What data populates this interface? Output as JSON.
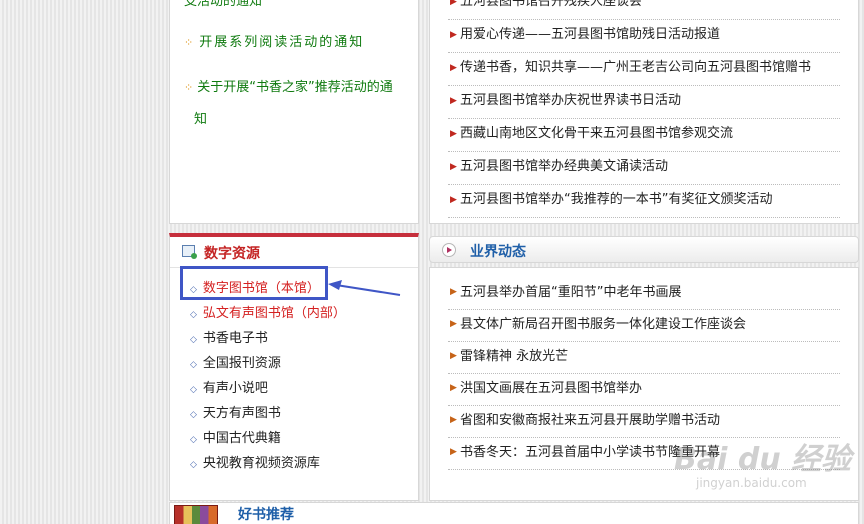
{
  "notices": [
    {
      "text": "支活动的通知",
      "cont": ""
    },
    {
      "text": "开展系列阅读活动的通知",
      "cont": ""
    },
    {
      "text": "关于开展“书香之家”推荐活动的通",
      "cont": "知"
    }
  ],
  "news_top": [
    "五河县图书馆召开残疾人座谈会",
    "用爱心传递——五河县图书馆助残日活动报道",
    "传递书香，知识共享——广州王老吉公司向五河县图书馆赠书",
    "五河县图书馆举办庆祝世界读书日活动",
    "西藏山南地区文化骨干来五河县图书馆参观交流",
    "五河县图书馆举办经典美文诵读活动",
    "五河县图书馆举办“我推荐的一本书”有奖征文颁奖活动"
  ],
  "digital_resources": {
    "title": "数字资源",
    "items": [
      {
        "label": "数字图书馆（本馆）",
        "highlight": true
      },
      {
        "label": "弘文有声图书馆（内部）",
        "highlight": true
      },
      {
        "label": "书香电子书",
        "highlight": false
      },
      {
        "label": "全国报刊资源",
        "highlight": false
      },
      {
        "label": "有声小说吧",
        "highlight": false
      },
      {
        "label": "天方有声图书",
        "highlight": false
      },
      {
        "label": "中国古代典籍",
        "highlight": false
      },
      {
        "label": "央视教育视频资源库",
        "highlight": false
      }
    ]
  },
  "industry_news": {
    "title": "业界动态",
    "items": [
      "五河县举办首届“重阳节”中老年书画展",
      "县文体广新局召开图书服务一体化建设工作座谈会",
      "雷锋精神 永放光芒",
      "洪国文画展在五河县图书馆举办",
      "省图和安徽商报社来五河县开展助学赠书活动",
      "书香冬天：五河县首届中小学读书节隆重开幕"
    ]
  },
  "book_recommend": {
    "title": "好书推荐"
  },
  "watermark": {
    "main": "Bai du 经验",
    "sub": "jingyan.baidu.com"
  },
  "colors": {
    "accent_red": "#c62f3c",
    "notice_green": "#0f7a0f",
    "annotation_blue": "#3f56c6",
    "section_blue": "#1f5fa8"
  }
}
